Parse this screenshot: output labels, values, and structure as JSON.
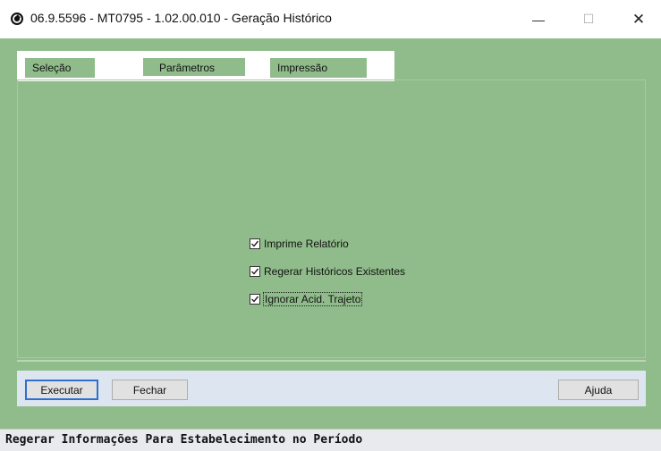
{
  "window": {
    "title": "06.9.5596 - MT0795 - 1.02.00.010 - Geração Histórico",
    "minimize_glyph": "—",
    "maximize_glyph": "☐",
    "close_glyph": "✕"
  },
  "tabs": [
    {
      "label": "Seleção"
    },
    {
      "label": "Parâmetros",
      "selected": true
    },
    {
      "label": "Impressão"
    }
  ],
  "options": [
    {
      "label": "Imprime Relatório",
      "checked": true
    },
    {
      "label": "Regerar Históricos Existentes",
      "checked": true
    },
    {
      "label": "Ignorar Acid. Trajeto",
      "checked": true
    }
  ],
  "buttons": {
    "executar": "Executar",
    "fechar": "Fechar",
    "ajuda": "Ajuda"
  },
  "status": {
    "text": "Regerar Informações Para Estabelecimento no Período"
  },
  "colors": {
    "background": "#8fbc8a",
    "button_bar": "#dde5f0",
    "focus_border": "#2f6fcf"
  },
  "icons": {
    "app": "app-circle-icon",
    "check": "check-icon"
  }
}
